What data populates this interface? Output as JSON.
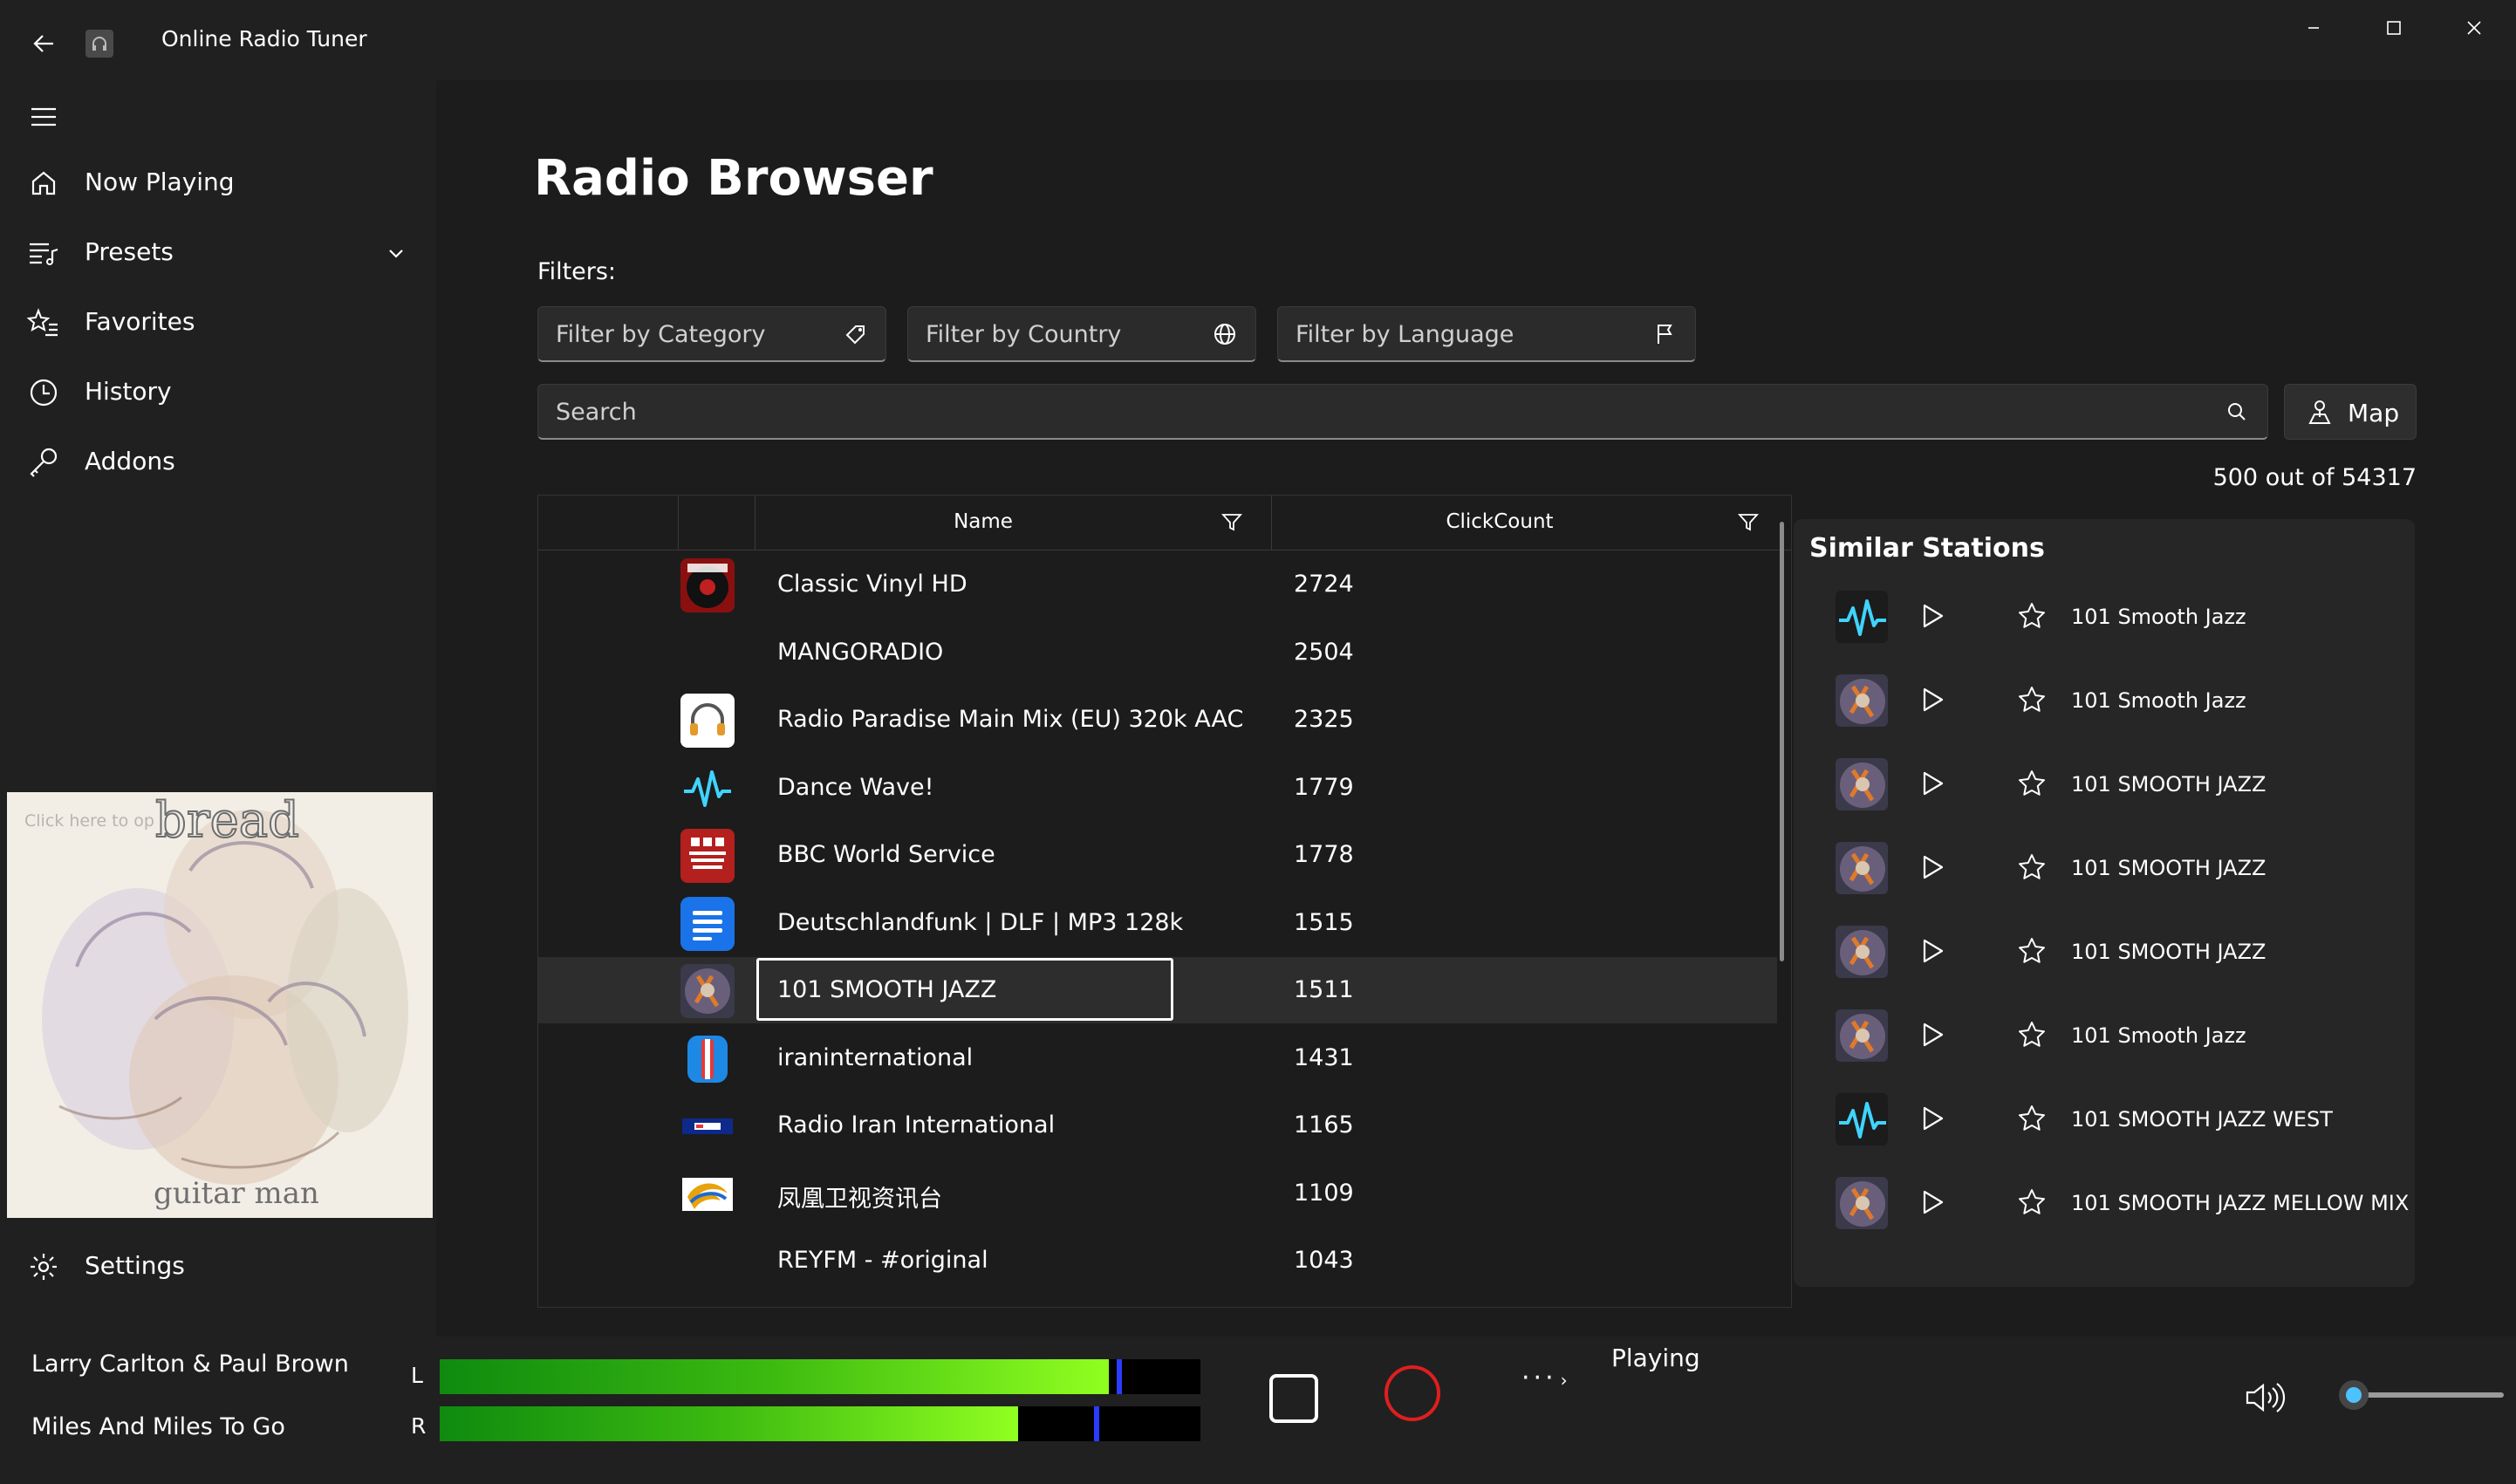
{
  "window": {
    "title": "Online Radio Tuner",
    "controls": [
      "minimize-icon",
      "maximize-icon",
      "close-icon"
    ]
  },
  "sidebar": {
    "items": [
      {
        "label": "Now Playing",
        "icon": "home-icon"
      },
      {
        "label": "Presets",
        "icon": "music-list-icon"
      },
      {
        "label": "Favorites",
        "icon": "star-list-icon"
      },
      {
        "label": "History",
        "icon": "clock-icon"
      },
      {
        "label": "Addons",
        "icon": "key-icon"
      }
    ],
    "settings_label": "Settings",
    "album_hint": "Click here to op",
    "album_band_text": "bread",
    "album_title_text": "guitar man"
  },
  "main": {
    "title": "Radio Browser",
    "filters_label": "Filters:",
    "filters": [
      {
        "placeholder": "Filter by Category",
        "icon": "tag-icon"
      },
      {
        "placeholder": "Filter by Country",
        "icon": "globe-icon"
      },
      {
        "placeholder": "Filter by Language",
        "icon": "flag-icon"
      }
    ],
    "search_placeholder": "Search",
    "map_label": "Map",
    "count_text": "500 out of 54317"
  },
  "grid": {
    "columns": [
      "Name",
      "ClickCount"
    ],
    "rows": [
      {
        "name": "Classic Vinyl HD",
        "count": "2724",
        "logo": "vinyl"
      },
      {
        "name": "MANGORADIO",
        "count": "2504",
        "logo": "none"
      },
      {
        "name": "Radio Paradise Main Mix (EU) 320k AAC",
        "count": "2325",
        "logo": "headphones"
      },
      {
        "name": "Dance Wave!",
        "count": "1779",
        "logo": "wave"
      },
      {
        "name": "BBC World Service",
        "count": "1778",
        "logo": "bbc"
      },
      {
        "name": "Deutschlandfunk | DLF | MP3 128k",
        "count": "1515",
        "logo": "dlf"
      },
      {
        "name": "101 SMOOTH JAZZ",
        "count": "1511",
        "logo": "jazz",
        "selected": true
      },
      {
        "name": "iraninternational",
        "count": "1431",
        "logo": "iran"
      },
      {
        "name": "Radio Iran International",
        "count": "1165",
        "logo": "rii"
      },
      {
        "name": "凤凰卫视资讯台",
        "count": "1109",
        "logo": "phoenix"
      },
      {
        "name": "REYFM - #original",
        "count": "1043",
        "logo": "none"
      }
    ]
  },
  "similar": {
    "title": "Similar Stations",
    "items": [
      {
        "name": "101 Smooth Jazz",
        "logo": "wave"
      },
      {
        "name": "101 Smooth Jazz",
        "logo": "jazz"
      },
      {
        "name": "101 SMOOTH JAZZ",
        "logo": "jazz"
      },
      {
        "name": "101 SMOOTH JAZZ",
        "logo": "jazz"
      },
      {
        "name": "101 SMOOTH JAZZ",
        "logo": "jazz"
      },
      {
        "name": "101 Smooth Jazz",
        "logo": "jazz"
      },
      {
        "name": "101 SMOOTH JAZZ WEST",
        "logo": "wave"
      },
      {
        "name": "101 SMOOTH JAZZ MELLOW MIX",
        "logo": "jazz"
      }
    ]
  },
  "player": {
    "artist": "Larry Carlton & Paul Brown",
    "track": "Miles And Miles To Go",
    "left_label": "L",
    "right_label": "R",
    "left_level": 0.88,
    "left_peak": 0.89,
    "right_level": 0.76,
    "right_peak": 0.86,
    "more_label": "···",
    "status": "Playing",
    "volume": 0.05
  }
}
